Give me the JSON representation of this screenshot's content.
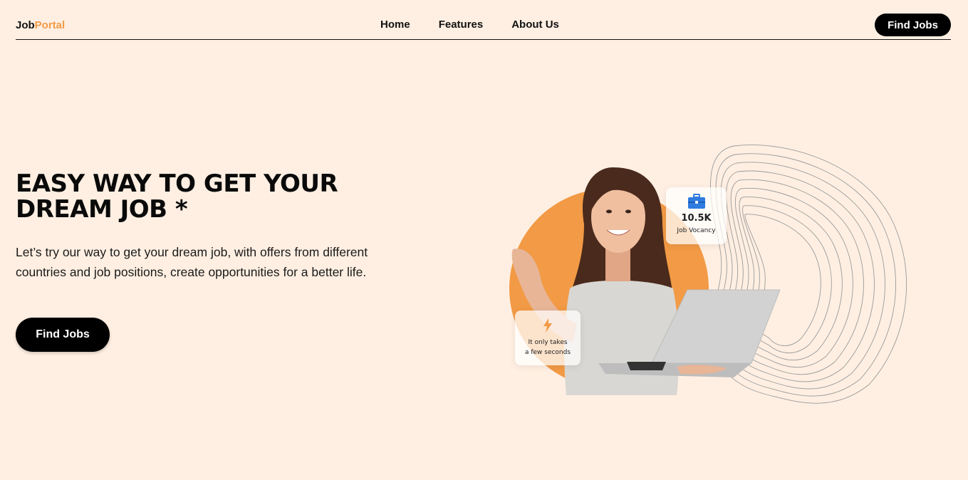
{
  "brand": {
    "part1": "Job",
    "part2": "Portal",
    "accent_color": "#f29a45"
  },
  "nav": {
    "links": [
      "Home",
      "Features",
      "About Us"
    ],
    "cta": "Find Jobs"
  },
  "hero": {
    "title_line1": "EASY WAY TO GET YOUR",
    "title_line2": "DREAM JOB *",
    "description": "Let’s try our way to get your dream job, with offers from different countries and job positions, create opportunities for a better life.",
    "cta": "Find Jobs"
  },
  "cards": {
    "vacancy": {
      "icon": "briefcase-icon",
      "count": "10.5K",
      "label": "Job Vocancy"
    },
    "speed": {
      "icon": "lightning-icon",
      "line1": "It only takes",
      "line2": "a few seconds"
    }
  },
  "colors": {
    "background": "#ffefe2",
    "primary": "#000000",
    "accent": "#f29a45",
    "briefcase": "#2f7be0"
  }
}
